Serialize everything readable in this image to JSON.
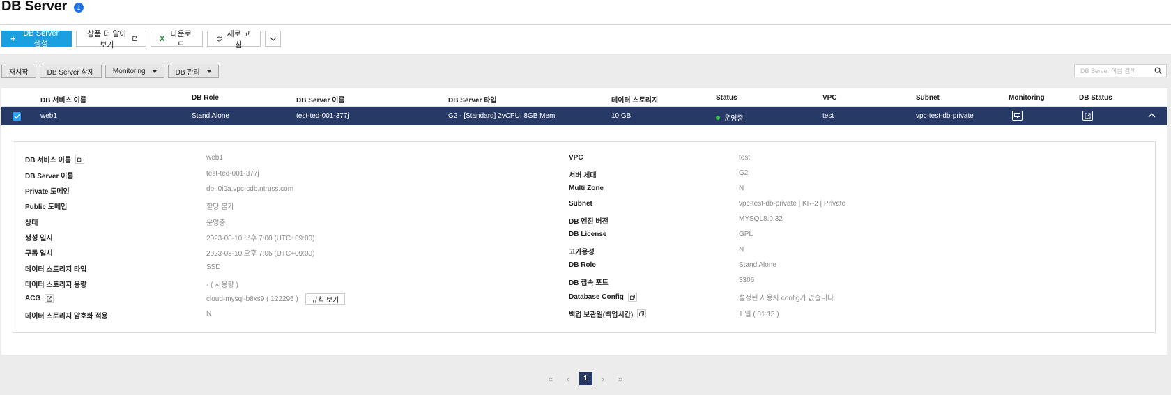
{
  "header": {
    "title": "DB Server",
    "count": "1"
  },
  "toolbar": {
    "create_label": "DB Server 생성",
    "learn_more_label": "상품 더 알아보기",
    "download_label": "다운로드",
    "refresh_label": "새로 고침"
  },
  "actions": {
    "restart": "재시작",
    "delete": "DB Server 삭제",
    "monitoring": "Monitoring",
    "db_manage": "DB 관리"
  },
  "search": {
    "placeholder": "DB Server 이름 검색"
  },
  "table": {
    "headers": [
      "DB 서비스 이름",
      "DB Role",
      "DB Server 이름",
      "DB Server 타입",
      "데이터 스토리지",
      "Status",
      "VPC",
      "Subnet",
      "Monitoring",
      "DB Status"
    ],
    "row": {
      "service_name": "web1",
      "role": "Stand Alone",
      "server_name": "test-ted-001-377j",
      "server_type": "G2 - [Standard] 2vCPU, 8GB Mem",
      "storage": "10 GB",
      "status": "운영중",
      "vpc": "test",
      "subnet": "vpc-test-db-private"
    }
  },
  "detail": {
    "left": [
      {
        "label": "DB 서비스 이름",
        "value": "web1"
      },
      {
        "label": "DB Server 이름",
        "value": "test-ted-001-377j"
      },
      {
        "label": "Private 도메인",
        "value": "db-i0i0a.vpc-cdb.ntruss.com"
      },
      {
        "label": "Public 도메인",
        "value": "할당 불가"
      },
      {
        "label": "상태",
        "value": "운영중"
      },
      {
        "label": "생성 일시",
        "value": "2023-08-10 오후 7:00 (UTC+09:00)"
      },
      {
        "label": "구동 일시",
        "value": "2023-08-10 오후 7:05 (UTC+09:00)"
      },
      {
        "label": "데이터 스토리지 타입",
        "value": "SSD"
      },
      {
        "label": "데이터 스토리지 용량",
        "value": "- ( 사용량 )"
      },
      {
        "label": "ACG",
        "value": "cloud-mysql-b8xs9 ( 122295 )"
      },
      {
        "label": "데이터 스토리지 암호화 적용",
        "value": "N"
      }
    ],
    "right": [
      {
        "label": "VPC",
        "value": "test"
      },
      {
        "label": "서버 세대",
        "value": "G2"
      },
      {
        "label": "Multi Zone",
        "value": "N"
      },
      {
        "label": "Subnet",
        "value": "vpc-test-db-private | KR-2 | Private"
      },
      {
        "label": "DB 엔진 버전",
        "value": "MYSQL8.0.32"
      },
      {
        "label": "DB License",
        "value": "GPL"
      },
      {
        "label": "고가용성",
        "value": "N"
      },
      {
        "label": "DB Role",
        "value": "Stand Alone"
      },
      {
        "label": "DB 접속 포트",
        "value": "3306"
      },
      {
        "label": "Database Config",
        "value": "설정된 사용자 config가 없습니다."
      },
      {
        "label": "백업 보관일(백업시간)",
        "value": "1 일 ( 01:15 )"
      }
    ],
    "rule_view_label": "규칙 보기"
  },
  "pagination": {
    "current": "1"
  },
  "colors": {
    "primary": "#1aa0e0",
    "selected_row": "#273a66",
    "status_running": "#35c24a",
    "badge": "#1e73e8"
  }
}
